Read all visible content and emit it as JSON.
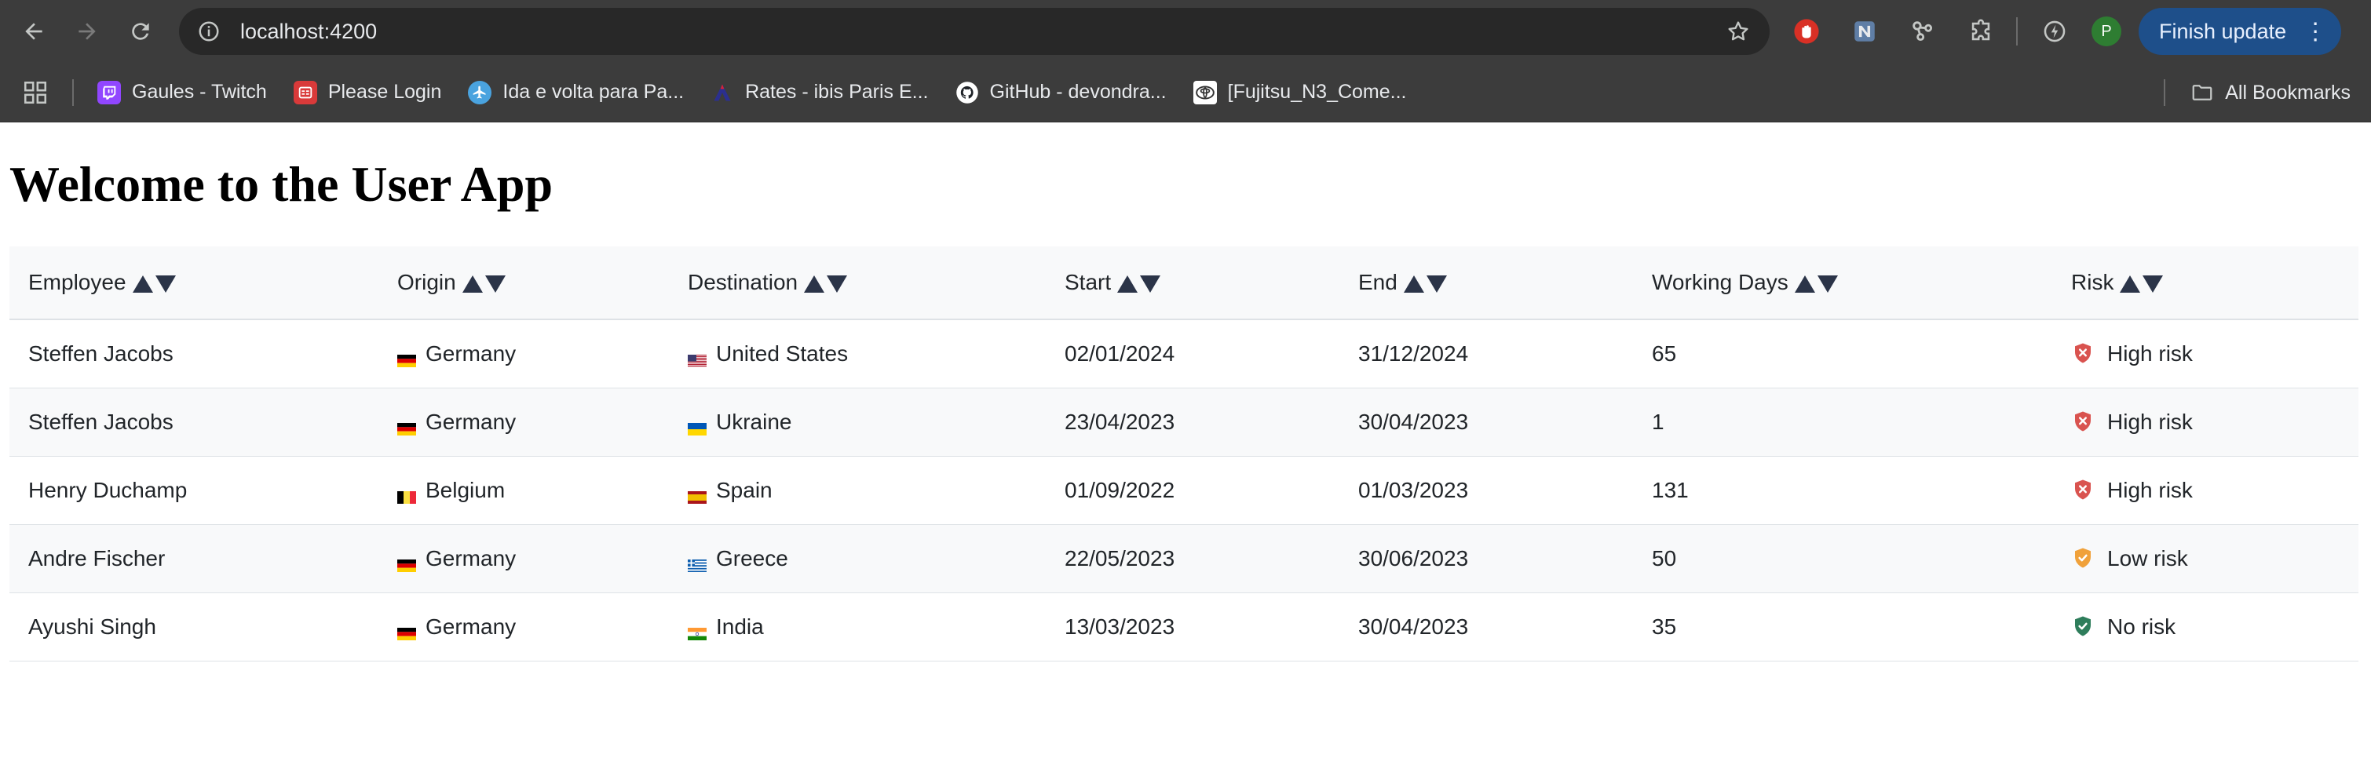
{
  "browser": {
    "url": "localhost:4200",
    "finish_update_label": "Finish update",
    "profile_initial": "P",
    "bookmarks": [
      {
        "label": "Gaules - Twitch",
        "icon": "twitch-icon"
      },
      {
        "label": "Please Login",
        "icon": "login-icon"
      },
      {
        "label": "Ida e volta para Pa...",
        "icon": "flight-icon"
      },
      {
        "label": "Rates - ibis Paris E...",
        "icon": "ibis-icon"
      },
      {
        "label": "GitHub - devondra...",
        "icon": "github-icon"
      },
      {
        "label": "[Fujitsu_N3_Come...",
        "icon": "toyota-icon"
      }
    ],
    "all_bookmarks_label": "All Bookmarks"
  },
  "page": {
    "title": "Welcome to the User App"
  },
  "table": {
    "columns": [
      "Employee",
      "Origin",
      "Destination",
      "Start",
      "End",
      "Working Days",
      "Risk"
    ],
    "rows": [
      {
        "employee": "Steffen Jacobs",
        "origin": "Germany",
        "origin_flag": "de",
        "destination": "United States",
        "destination_flag": "us",
        "start": "02/01/2024",
        "end": "31/12/2024",
        "working_days": "65",
        "risk": "High risk",
        "risk_level": "high"
      },
      {
        "employee": "Steffen Jacobs",
        "origin": "Germany",
        "origin_flag": "de",
        "destination": "Ukraine",
        "destination_flag": "ua",
        "start": "23/04/2023",
        "end": "30/04/2023",
        "working_days": "1",
        "risk": "High risk",
        "risk_level": "high"
      },
      {
        "employee": "Henry Duchamp",
        "origin": "Belgium",
        "origin_flag": "be",
        "destination": "Spain",
        "destination_flag": "es",
        "start": "01/09/2022",
        "end": "01/03/2023",
        "working_days": "131",
        "risk": "High risk",
        "risk_level": "high"
      },
      {
        "employee": "Andre Fischer",
        "origin": "Germany",
        "origin_flag": "de",
        "destination": "Greece",
        "destination_flag": "gr",
        "start": "22/05/2023",
        "end": "30/06/2023",
        "working_days": "50",
        "risk": "Low risk",
        "risk_level": "low"
      },
      {
        "employee": "Ayushi Singh",
        "origin": "Germany",
        "origin_flag": "de",
        "destination": "India",
        "destination_flag": "in",
        "start": "13/03/2023",
        "end": "30/04/2023",
        "working_days": "35",
        "risk": "No risk",
        "risk_level": "none"
      }
    ]
  },
  "colors": {
    "high_risk": "#d9534f",
    "low_risk": "#f0a13a",
    "no_risk": "#2e7d5b",
    "header_bg": "#f8f9fa",
    "chrome_bg": "#3c3c3c",
    "update_button": "#1e4f8a"
  }
}
